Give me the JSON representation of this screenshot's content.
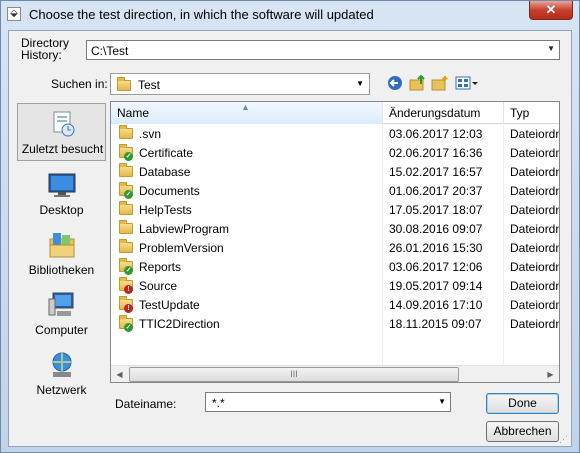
{
  "window": {
    "title": "Choose the test direction, in which the software will updated",
    "close_label": "✕"
  },
  "history": {
    "label_line1": "Directory",
    "label_line2": "History:",
    "value": "C:\\Test"
  },
  "lookin": {
    "label": "Suchen in:",
    "value": "Test"
  },
  "toolbar": {
    "back_icon": "back-arrow-icon",
    "up_icon": "up-folder-icon",
    "new_folder_icon": "new-folder-icon",
    "view_menu_icon": "view-menu-icon"
  },
  "places": [
    {
      "label": "Zuletzt besucht",
      "icon": "recent-places-icon",
      "active": true
    },
    {
      "label": "Desktop",
      "icon": "desktop-icon",
      "active": false
    },
    {
      "label": "Bibliotheken",
      "icon": "libraries-icon",
      "active": false
    },
    {
      "label": "Computer",
      "icon": "computer-icon",
      "active": false
    },
    {
      "label": "Netzwerk",
      "icon": "network-icon",
      "active": false
    }
  ],
  "columns": {
    "name": "Name",
    "date": "Änderungsdatum",
    "type": "Typ"
  },
  "files": [
    {
      "name": ".svn",
      "date": "03.06.2017 12:03",
      "type": "Dateiordn",
      "status": "none"
    },
    {
      "name": "Certificate",
      "date": "02.06.2017 16:36",
      "type": "Dateiordn",
      "status": "ok"
    },
    {
      "name": "Database",
      "date": "15.02.2017 16:57",
      "type": "Dateiordn",
      "status": "none"
    },
    {
      "name": "Documents",
      "date": "01.06.2017 20:37",
      "type": "Dateiordn",
      "status": "ok"
    },
    {
      "name": "HelpTests",
      "date": "17.05.2017 18:07",
      "type": "Dateiordn",
      "status": "none"
    },
    {
      "name": "LabviewProgram",
      "date": "30.08.2016 09:07",
      "type": "Dateiordn",
      "status": "none"
    },
    {
      "name": "ProblemVersion",
      "date": "26.01.2016 15:30",
      "type": "Dateiordn",
      "status": "none"
    },
    {
      "name": "Reports",
      "date": "03.06.2017 12:06",
      "type": "Dateiordn",
      "status": "ok"
    },
    {
      "name": "Source",
      "date": "19.05.2017 09:14",
      "type": "Dateiordn",
      "status": "err"
    },
    {
      "name": "TestUpdate",
      "date": "14.09.2016 17:10",
      "type": "Dateiordn",
      "status": "err"
    },
    {
      "name": "TTIC2Direction",
      "date": "18.11.2015 09:07",
      "type": "Dateiordn",
      "status": "ok"
    }
  ],
  "scroll": {
    "thumb_grip": "III",
    "left_arrow": "◀",
    "right_arrow": "▶"
  },
  "filename": {
    "label": "Dateiname:",
    "value": "*.*"
  },
  "buttons": {
    "ok": "Done",
    "cancel": "Abbrechen"
  }
}
